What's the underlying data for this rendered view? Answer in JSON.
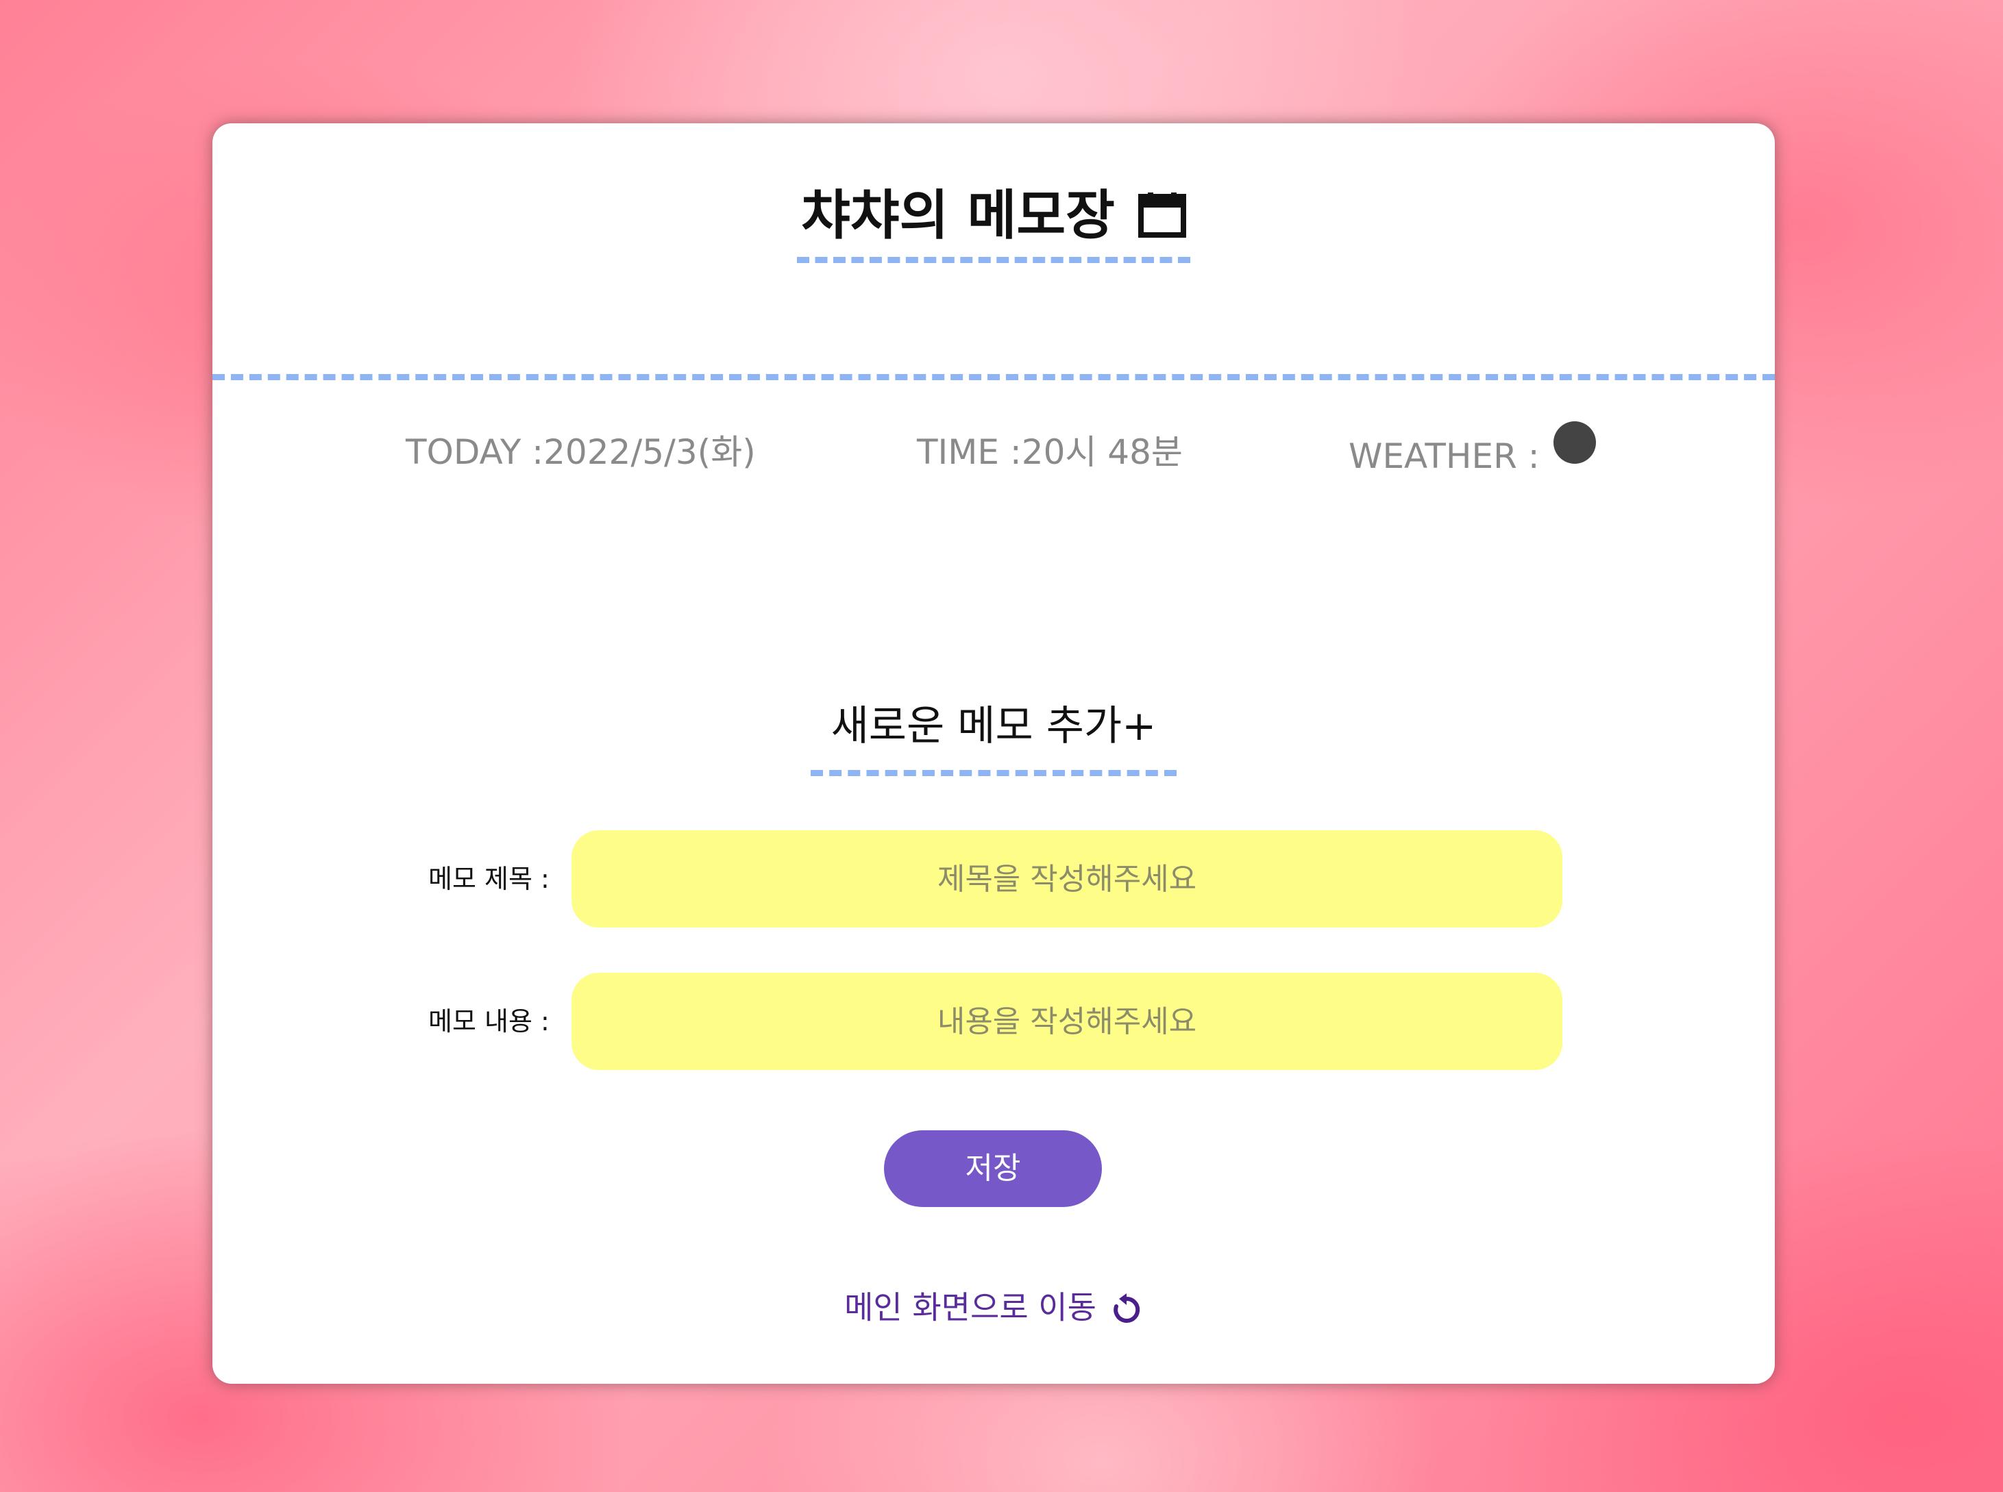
{
  "header": {
    "title": "챠챠의 메모장",
    "title_icon": "calendar-icon",
    "today_label": "TODAY :",
    "today_value": "2022/5/3(화)",
    "time_label": "TIME :",
    "time_value": "20시 48분",
    "weather_label": "WEATHER :",
    "weather_icon": "weather-dot-icon"
  },
  "form": {
    "section_title": "새로운 메모 추가+",
    "title_field": {
      "label": "메모 제목 :",
      "placeholder": "제목을 작성해주세요",
      "value": ""
    },
    "content_field": {
      "label": "메모 내용 :",
      "placeholder": "내용을 작성해주세요",
      "value": ""
    },
    "save_label": "저장"
  },
  "footer": {
    "home_link_label": "메인 화면으로 이동",
    "home_link_icon": "refresh-icon"
  },
  "colors": {
    "accent_dash": "#8fb4f3",
    "input_bg": "#fdfd88",
    "button_bg": "#7658c9",
    "link": "#5a2b9a",
    "background": "#ff8fa3"
  }
}
